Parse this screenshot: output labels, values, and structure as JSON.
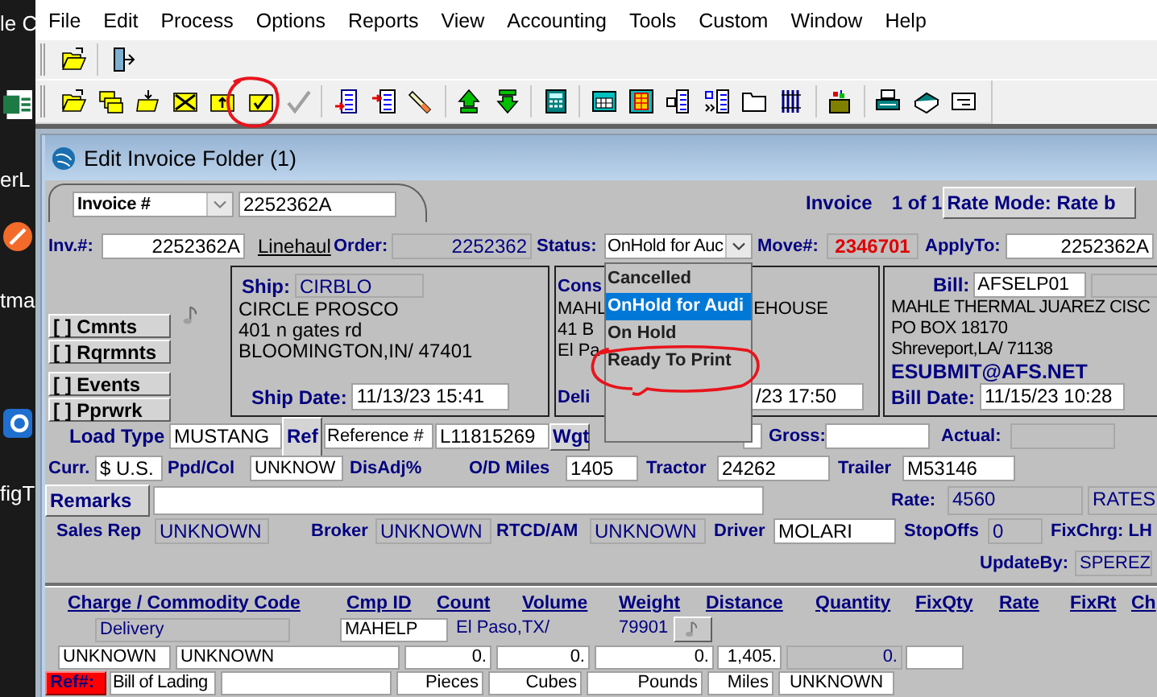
{
  "desktop": {
    "labels": [
      "le C",
      "erL",
      "tma",
      "figT"
    ]
  },
  "menu": [
    "File",
    "Edit",
    "Process",
    "Options",
    "Reports",
    "View",
    "Accounting",
    "Tools",
    "Custom",
    "Window",
    "Help"
  ],
  "toolbar_1": [
    {
      "disabled": false
    },
    {
      "disabled": false
    }
  ],
  "toolbar_2": [
    {
      "disabled": false
    },
    {
      "disabled": false
    },
    {
      "disabled": false
    },
    {
      "disabled": false
    },
    {
      "disabled": false
    },
    {
      "disabled": false
    },
    {
      "disabled": true
    },
    {
      "disabled": false
    },
    {
      "disabled": false
    },
    {
      "disabled": false
    },
    {
      "disabled": false
    },
    {
      "disabled": false
    },
    {
      "disabled": false
    },
    {
      "disabled": false
    },
    {
      "disabled": false
    },
    {
      "disabled": false
    },
    {
      "disabled": false
    },
    {
      "disabled": false
    },
    {
      "disabled": false
    },
    {
      "disabled": false
    },
    {
      "disabled": false
    },
    {
      "disabled": false
    },
    {
      "disabled": false
    }
  ],
  "window": {
    "title": "Edit Invoice Folder (1)"
  },
  "search": {
    "field": "Invoice #",
    "value": "2252362A"
  },
  "record": {
    "label": "Invoice",
    "position": "1 of 1"
  },
  "rate_mode_button": "Rate Mode: Rate b",
  "order_row": [
    {
      "kind": "label",
      "text": "Inv.#:"
    },
    {
      "kind": "field",
      "text": "2252362A"
    },
    {
      "kind": "link",
      "text": "Linehaul"
    },
    {
      "kind": "label",
      "text": "Order:"
    },
    {
      "kind": "readonly",
      "text": "2252362"
    },
    {
      "kind": "label",
      "text": "Status:"
    },
    {
      "kind": "combo",
      "text": "OnHold for Auc"
    },
    {
      "kind": "label",
      "text": "Move#:"
    },
    {
      "kind": "alert",
      "text": "2346701"
    },
    {
      "kind": "label",
      "text": "ApplyTo:"
    },
    {
      "kind": "field",
      "text": "2252362A"
    }
  ],
  "status_dropdown": [
    {
      "label": "Cancelled",
      "selected": false
    },
    {
      "label": "OnHold for Audi",
      "selected": true
    },
    {
      "label": "On Hold",
      "selected": false
    },
    {
      "label": "Ready To Print",
      "selected": false
    }
  ],
  "side_buttons": [
    "[ ] Cmnts",
    "[ ] Rqrmnts",
    "[ ] Events",
    "[ ] Pprwrk"
  ],
  "ship": {
    "label": "Ship:",
    "code": "CIRBLO",
    "lines": [
      "CIRCLE PROSCO",
      "401 n gates rd",
      "BLOOMINGTON,IN/ 47401"
    ],
    "date_label": "Ship Date:",
    "date": "11/13/23 15:41"
  },
  "consignee": {
    "label": "Cons",
    "line_1": [
      "MAHL",
      "EHOUSE"
    ],
    "lines": [
      "41 B",
      "El Pa"
    ],
    "date_label": "Deli",
    "date": "/23 17:50"
  },
  "bill": {
    "label": "Bill:",
    "code": "AFSELP01",
    "lines": [
      "MAHLE THERMAL JUAREZ CISC",
      "PO BOX 18170",
      "Shreveport,LA/ 71138"
    ],
    "email": "ESUBMIT@AFS.NET",
    "date_label": "Bill Date:",
    "date": "11/15/23 10:28"
  },
  "form_rows": [
    [
      {
        "kind": "label",
        "text": "Load Type"
      },
      {
        "kind": "field",
        "text": "MUSTANG"
      },
      {
        "kind": "button",
        "text": "Ref"
      },
      {
        "kind": "field",
        "text": "Reference #"
      },
      {
        "kind": "field",
        "text": "L11815269"
      },
      {
        "kind": "button",
        "text": "Wgt"
      },
      {
        "kind": "field"
      },
      {
        "kind": "label",
        "text": "Gross:"
      },
      {
        "kind": "field"
      },
      {
        "kind": "label",
        "text": "Actual:"
      },
      {
        "kind": "readonly"
      }
    ],
    [
      {
        "kind": "label",
        "text": "Curr."
      },
      {
        "kind": "field",
        "text": "$ U.S."
      },
      {
        "kind": "label",
        "text": "Ppd/Col"
      },
      {
        "kind": "field",
        "text": "UNKNOW"
      },
      {
        "kind": "label",
        "text": "DisAdj%"
      },
      {
        "kind": "label",
        "text": "O/D Miles"
      },
      {
        "kind": "field",
        "text": "1405"
      },
      {
        "kind": "label",
        "text": "Tractor"
      },
      {
        "kind": "field",
        "text": "24262"
      },
      {
        "kind": "label",
        "text": "Trailer"
      },
      {
        "kind": "field",
        "text": "M53146"
      }
    ],
    [
      {
        "kind": "button",
        "text": "Remarks"
      },
      {
        "kind": "field"
      },
      {
        "kind": "label",
        "text": "Rate:"
      },
      {
        "kind": "readonly",
        "text": "4560"
      },
      {
        "kind": "readonly",
        "text": "RATES"
      }
    ],
    [
      {
        "kind": "label",
        "text": "Sales Rep"
      },
      {
        "kind": "readonly",
        "text": "UNKNOWN"
      },
      {
        "kind": "label",
        "text": "Broker"
      },
      {
        "kind": "readonly",
        "text": "UNKNOWN"
      },
      {
        "kind": "label",
        "text": "RTCD/AM"
      },
      {
        "kind": "readonly",
        "text": "UNKNOWN"
      },
      {
        "kind": "label",
        "text": "Driver"
      },
      {
        "kind": "field",
        "text": "MOLARI"
      },
      {
        "kind": "label",
        "text": "StopOffs"
      },
      {
        "kind": "readonly",
        "text": "0"
      },
      {
        "kind": "label",
        "text": "FixChrg: LH"
      }
    ],
    [
      {
        "kind": "label",
        "text": "UpdateBy:"
      },
      {
        "kind": "readonly",
        "text": "SPEREZ"
      }
    ]
  ],
  "charge_lines": {
    "headers": [
      "Charge / Commodity Code",
      "Cmp ID",
      "Count",
      "Volume",
      "Weight",
      "Distance",
      "Quantity",
      "FixQty",
      "Rate",
      "FixRt",
      "Ch"
    ],
    "lines": [
      [
        {
          "kind": "readonly",
          "text": "Delivery"
        },
        {
          "kind": "field",
          "text": "MAHELP"
        },
        {
          "kind": "text",
          "text": "El Paso,TX/"
        },
        {
          "kind": "text",
          "text": "79901"
        },
        {
          "kind": "note_button"
        }
      ],
      [
        {
          "kind": "field",
          "text": "UNKNOWN"
        },
        {
          "kind": "field",
          "text": "UNKNOWN"
        },
        {
          "kind": "field",
          "text": "0."
        },
        {
          "kind": "field",
          "text": "0."
        },
        {
          "kind": "field",
          "text": "0."
        },
        {
          "kind": "field",
          "text": "1,405."
        },
        {
          "kind": "readonly",
          "text": "0."
        },
        {
          "kind": "field"
        }
      ],
      [
        {
          "kind": "ref_button",
          "text": "Ref#:"
        },
        {
          "kind": "field",
          "text": "Bill of Lading"
        },
        {
          "kind": "field"
        },
        {
          "kind": "field",
          "text": "Pieces"
        },
        {
          "kind": "field",
          "text": "Cubes"
        },
        {
          "kind": "field",
          "text": "Pounds"
        },
        {
          "kind": "field",
          "text": "Miles"
        },
        {
          "kind": "field",
          "text": "UNKNOWN"
        }
      ]
    ]
  }
}
